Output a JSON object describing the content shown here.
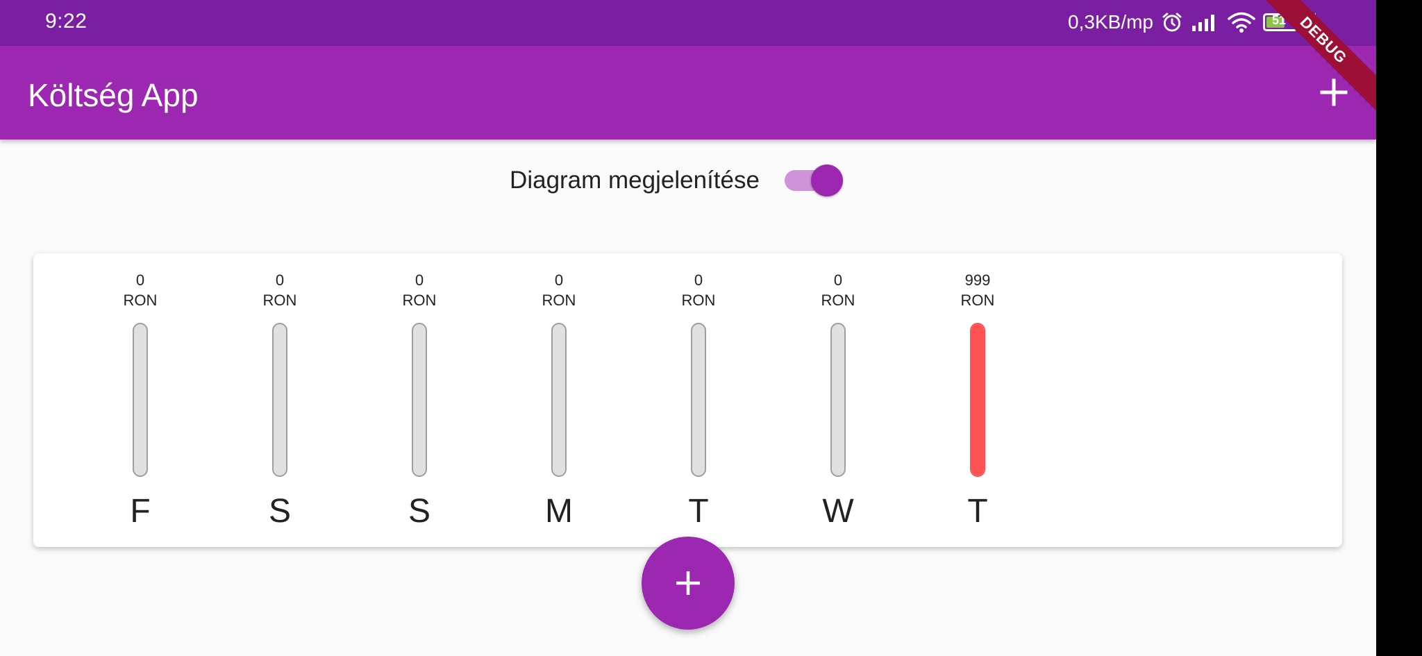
{
  "status_bar": {
    "time": "9:22",
    "network_speed": "0,3KB/mp",
    "battery_level": "51",
    "icons": [
      "alarm-icon",
      "signal-icon",
      "wifi-icon",
      "battery-icon",
      "charging-icon"
    ]
  },
  "debug_banner": "DEBUG",
  "app_bar": {
    "title": "Költség App",
    "action_icon": "add-icon"
  },
  "chart_toggle": {
    "label": "Diagram megjelenítése",
    "enabled": true
  },
  "chart_data": {
    "type": "bar",
    "categories": [
      "F",
      "S",
      "S",
      "M",
      "T",
      "W",
      "T"
    ],
    "values": [
      0,
      0,
      0,
      0,
      0,
      0,
      999
    ],
    "amount_labels": [
      "0",
      "0",
      "0",
      "0",
      "0",
      "0",
      "999"
    ],
    "unit": "RON"
  },
  "fab": {
    "icon": "add-icon"
  },
  "colors": {
    "primary": "#9c27b0",
    "primary_dark": "#7b1fa2",
    "bar_fill": "#ff5252",
    "bar_track": "#e0e0e0",
    "switch_track": "#ce93d8"
  }
}
